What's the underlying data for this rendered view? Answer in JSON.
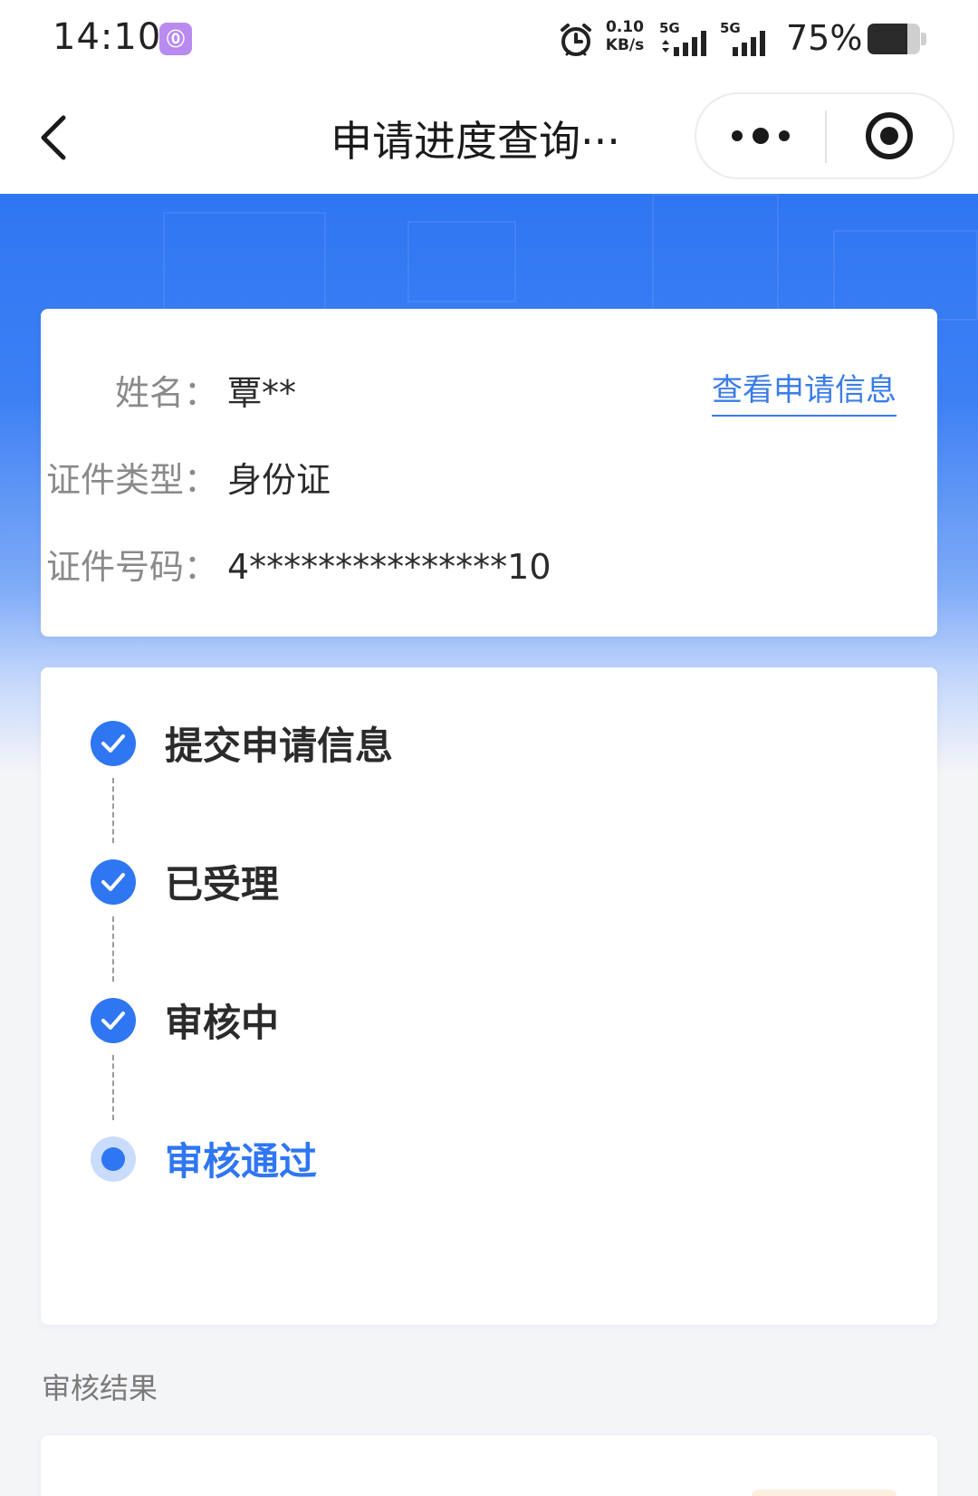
{
  "status_bar": {
    "time": "14:10",
    "app_icon_glyph": "⓪",
    "net_speed_value": "0.10",
    "net_speed_unit": "KB/s",
    "sim1_label": "5G",
    "sim2_label": "5G",
    "battery_percent": "75%",
    "battery_level": 0.75
  },
  "nav": {
    "title": "申请进度查询···",
    "icons": [
      "chevron-left-icon",
      "more-dots-icon",
      "target-circle-icon"
    ]
  },
  "info": {
    "name_label": "姓名：",
    "name_value": "覃**",
    "view_link": "查看申请信息",
    "id_type_label": "证件类型：",
    "id_type_value": "身份证",
    "id_number_label": "证件号码：",
    "id_number_value": "4***************10"
  },
  "progress": {
    "steps": [
      {
        "label": "提交申请信息",
        "state": "done"
      },
      {
        "label": "已受理",
        "state": "done"
      },
      {
        "label": "审核中",
        "state": "done"
      },
      {
        "label": "审核通过",
        "state": "current"
      }
    ]
  },
  "result": {
    "section_title": "审核结果"
  },
  "colors": {
    "accent": "#2f76f2",
    "link": "#3a7ce8",
    "page_bg": "#f4f5f7"
  }
}
